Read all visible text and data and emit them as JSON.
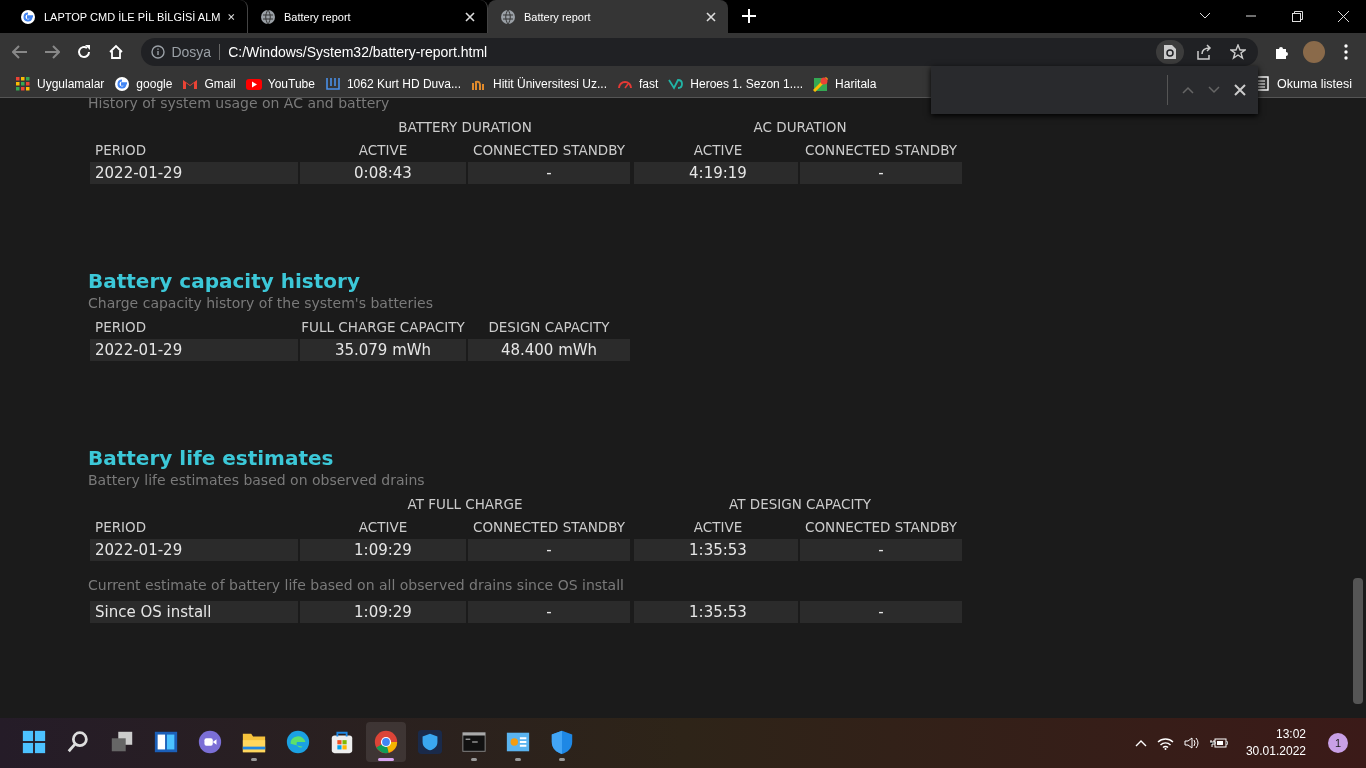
{
  "tabs": [
    {
      "title": "LAPTOP CMD İLE PİL BİLGİSİ ALM",
      "kind": "google",
      "selected": false
    },
    {
      "title": "Battery report",
      "kind": "globe",
      "selected": false
    },
    {
      "title": "Battery report",
      "kind": "globe",
      "selected": true
    }
  ],
  "address": {
    "scheme": "Dosya",
    "url": "C:/Windows/System32/battery-report.html"
  },
  "bookmarks": [
    {
      "label": "Uygulamalar",
      "kind": "apps"
    },
    {
      "label": "google",
      "kind": "google"
    },
    {
      "label": "Gmail",
      "kind": "gmail"
    },
    {
      "label": "YouTube",
      "kind": "youtube"
    },
    {
      "label": "1062 Kurt HD Duva...",
      "kind": "bracket"
    },
    {
      "label": "Hitit Üniversitesi Uz...",
      "kind": "logo"
    },
    {
      "label": "fast",
      "kind": "gauge"
    },
    {
      "label": "Heroes 1. Sezon 1....",
      "kind": "wave"
    },
    {
      "label": "Haritala",
      "kind": "map"
    }
  ],
  "reading_list": "Okuma listesi",
  "sections": [
    {
      "subtitle": "History of system usage on AC and battery",
      "groups": [
        "BATTERY DURATION",
        "AC DURATION"
      ],
      "columns": [
        "PERIOD",
        "ACTIVE",
        "CONNECTED STANDBY",
        "ACTIVE",
        "CONNECTED STANDBY"
      ],
      "rows": [
        [
          "2022-01-29",
          "0:08:43",
          "-",
          "4:19:19",
          "-"
        ]
      ]
    },
    {
      "title": "Battery capacity history",
      "subtitle": "Charge capacity history of the system's batteries",
      "columns": [
        "PERIOD",
        "FULL CHARGE CAPACITY",
        "DESIGN CAPACITY"
      ],
      "rows": [
        [
          "2022-01-29",
          "35.079 mWh",
          "48.400 mWh"
        ]
      ]
    },
    {
      "title": "Battery life estimates",
      "subtitle": "Battery life estimates based on observed drains",
      "groups": [
        "AT FULL CHARGE",
        "AT DESIGN CAPACITY"
      ],
      "columns": [
        "PERIOD",
        "ACTIVE",
        "CONNECTED STANDBY",
        "ACTIVE",
        "CONNECTED STANDBY"
      ],
      "rows": [
        [
          "2022-01-29",
          "1:09:29",
          "-",
          "1:35:53",
          "-"
        ]
      ],
      "note": "Current estimate of battery life based on all observed drains since OS install",
      "note_rows": [
        [
          "Since OS install",
          "1:09:29",
          "-",
          "1:35:53",
          "-"
        ]
      ]
    }
  ],
  "taskbar": {
    "apps": [
      {
        "kind": "start",
        "running": false,
        "selected": false
      },
      {
        "kind": "search",
        "running": false,
        "selected": false
      },
      {
        "kind": "taskview",
        "running": false,
        "selected": false
      },
      {
        "kind": "widgets",
        "running": false,
        "selected": false
      },
      {
        "kind": "chat",
        "running": false,
        "selected": false
      },
      {
        "kind": "folder",
        "running": true,
        "selected": false
      },
      {
        "kind": "edge",
        "running": false,
        "selected": false
      },
      {
        "kind": "store",
        "running": false,
        "selected": false
      },
      {
        "kind": "chrome",
        "running": true,
        "selected": true
      },
      {
        "kind": "shield",
        "running": false,
        "selected": false
      },
      {
        "kind": "terminal",
        "running": true,
        "selected": false
      },
      {
        "kind": "panel",
        "running": true,
        "selected": false
      },
      {
        "kind": "defender",
        "running": true,
        "selected": false
      }
    ],
    "time": "13:02",
    "date": "30.01.2022",
    "notifications": "1"
  }
}
